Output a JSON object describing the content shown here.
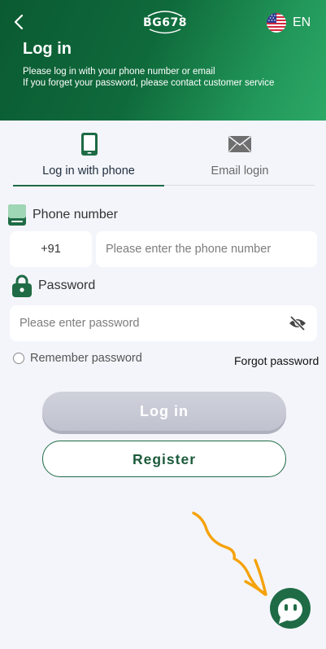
{
  "header": {
    "logo_text": "BG678",
    "language": "EN",
    "title": "Log in",
    "subtitle_line1": "Please log in with your phone number or email",
    "subtitle_line2": "If you forget your password, please contact customer service"
  },
  "tabs": [
    {
      "label": "Log in with phone",
      "active": true
    },
    {
      "label": "Email login",
      "active": false
    }
  ],
  "phone": {
    "label": "Phone number",
    "country_code": "+91",
    "placeholder": "Please enter the phone number",
    "value": ""
  },
  "password": {
    "label": "Password",
    "placeholder": "Please enter password",
    "value": ""
  },
  "remember_label": "Remember password",
  "forgot_label": "Forgot password",
  "login_label": "Log in",
  "register_label": "Register",
  "colors": {
    "brand_green": "#1e6b45",
    "header_dark": "#0b5a32",
    "header_light": "#2ca866",
    "login_disabled": "#c4c6d2",
    "annotation_orange": "#f5a20a"
  }
}
